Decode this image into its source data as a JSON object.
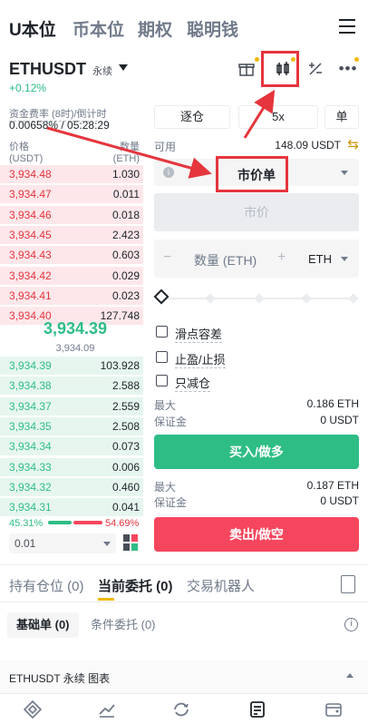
{
  "top_tabs": [
    "U本位",
    "币本位",
    "期权",
    "聪明钱"
  ],
  "symbol": {
    "name": "ETHUSDT",
    "tag": "永续",
    "change": "+0.12%"
  },
  "funding": {
    "label": "资金费率 (8时)/倒计时",
    "value": "0.00658% / 05:28:29"
  },
  "orderbook": {
    "price_header": "价格\n(USDT)",
    "price_header_l1": "价格",
    "price_header_l2": "(USDT)",
    "qty_header_l1": "数量",
    "qty_header_l2": "(ETH)",
    "asks": [
      {
        "p": "3,934.48",
        "q": "1.030"
      },
      {
        "p": "3,934.47",
        "q": "0.011"
      },
      {
        "p": "3,934.46",
        "q": "0.018"
      },
      {
        "p": "3,934.45",
        "q": "2.423"
      },
      {
        "p": "3,934.43",
        "q": "0.603"
      },
      {
        "p": "3,934.42",
        "q": "0.029"
      },
      {
        "p": "3,934.41",
        "q": "0.023"
      },
      {
        "p": "3,934.40",
        "q": "127.748"
      }
    ],
    "last_price": "3,934.39",
    "mark_price": "3,934.09",
    "bids": [
      {
        "p": "3,934.39",
        "q": "103.928"
      },
      {
        "p": "3,934.38",
        "q": "2.588"
      },
      {
        "p": "3,934.37",
        "q": "2.559"
      },
      {
        "p": "3,934.35",
        "q": "2.508"
      },
      {
        "p": "3,934.34",
        "q": "0.073"
      },
      {
        "p": "3,934.33",
        "q": "0.006"
      },
      {
        "p": "3,934.32",
        "q": "0.460"
      },
      {
        "p": "3,934.31",
        "q": "0.041"
      }
    ],
    "buy_ratio": "45.31%",
    "sell_ratio": "54.69%",
    "buy_fraction": 0.4531,
    "depth": "0.01"
  },
  "order_form": {
    "margin_mode": "逐仓",
    "leverage": "5x",
    "position_side": "单",
    "available_label": "可用",
    "available_value": "148.09 USDT",
    "order_type": "市价单",
    "price_placeholder": "市价",
    "qty_label": "数量 (ETH)",
    "qty_unit": "ETH",
    "options": [
      "滑点容差",
      "止盈/止损",
      "只减仓"
    ],
    "buy": {
      "max_label": "最大",
      "max_value": "0.186 ETH",
      "margin_label": "保证金",
      "margin_value": "0 USDT",
      "button": "买入/做多"
    },
    "sell": {
      "max_label": "最大",
      "max_value": "0.187 ETH",
      "margin_label": "保证金",
      "margin_value": "0 USDT",
      "button": "卖出/做空"
    }
  },
  "bottom_tabs": [
    "持有仓位 (0)",
    "当前委托 (0)",
    "交易机器人"
  ],
  "sub_tabs": [
    "基础单 (0)",
    "条件委托 (0)"
  ],
  "chart_bar": "ETHUSDT 永续  图表",
  "colors": {
    "buy": "#2ebd85",
    "sell": "#f6465d",
    "accent": "#f0b90b",
    "annotation": "#e5353d"
  }
}
